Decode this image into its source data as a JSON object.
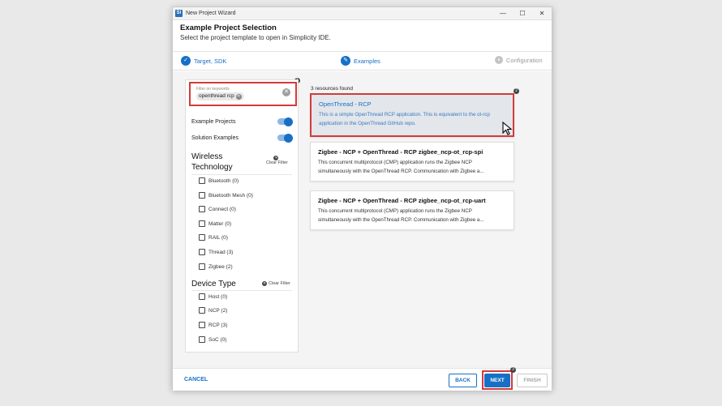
{
  "window": {
    "title": "New Project Wizard",
    "icon_label": "Si",
    "controls": [
      "—",
      "☐",
      "✕"
    ]
  },
  "header": {
    "title": "Example Project Selection",
    "subtitle": "Select the project template to open in Simplicity IDE."
  },
  "steps": [
    {
      "label": "Target, SDK",
      "state": "done",
      "icon": "✓"
    },
    {
      "label": "Examples",
      "state": "active",
      "icon": "✎"
    },
    {
      "label": "Configuration",
      "state": "inactive",
      "icon": "●"
    }
  ],
  "filter": {
    "placeholder": "Filter on keywords",
    "chip": "openthread rcp",
    "badge": "1",
    "toggles": [
      {
        "label": "Example Projects",
        "on": true
      },
      {
        "label": "Solution Examples",
        "on": true
      }
    ],
    "clear_filter_label": "Clear Filter",
    "wireless": {
      "title_line1": "Wireless",
      "title_line2": "Technology",
      "items": [
        "Bluetooth (0)",
        "Bluetooth Mesh (0)",
        "Connect (0)",
        "Matter (0)",
        "RAIL (0)",
        "Thread (3)",
        "Zigbee (2)"
      ]
    },
    "device": {
      "title": "Device Type",
      "items": [
        "Host (0)",
        "NCP (2)",
        "RCP (3)",
        "SoC (0)"
      ]
    }
  },
  "results": {
    "count": "3 resources found",
    "badge": "2",
    "cards": [
      {
        "title": "OpenThread - RCP",
        "desc": "This is a simple OpenThread RCP application. This is equivalent to the ot-rcp application in the OpenThread GitHub repo.",
        "selected": true
      },
      {
        "title": "Zigbee - NCP + OpenThread - RCP zigbee_ncp-ot_rcp-spi",
        "desc": "This concurrent multiprotocol (CMP) application runs the Zigbee NCP simultaneously with the OpenThread RCP. Communication with Zigbee a...",
        "selected": false
      },
      {
        "title": "Zigbee - NCP + OpenThread - RCP zigbee_ncp-ot_rcp-uart",
        "desc": "This concurrent multiprotocol (CMP) application runs the Zigbee NCP simultaneously with the OpenThread RCP. Communication with Zigbee a...",
        "selected": false
      }
    ]
  },
  "footer": {
    "cancel": "CANCEL",
    "back": "BACK",
    "next": "NEXT",
    "finish": "FINISH",
    "next_badge": "3"
  },
  "colors": {
    "accent": "#1770c5",
    "highlight": "#d43a3a"
  }
}
